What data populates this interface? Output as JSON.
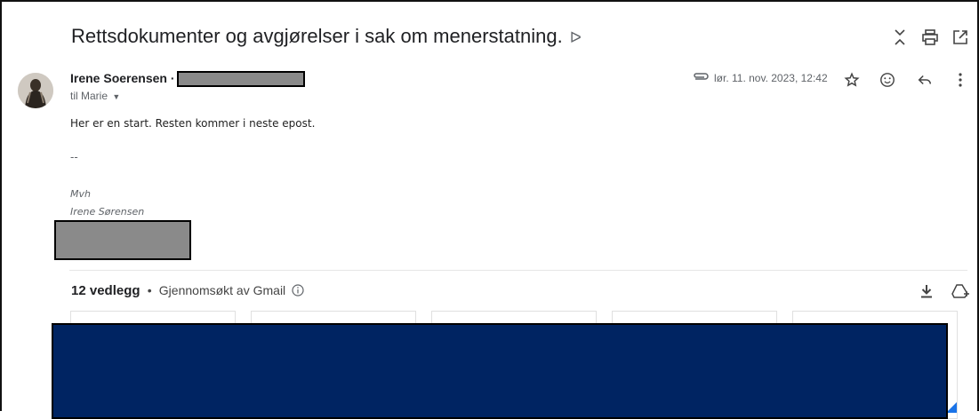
{
  "email": {
    "subject": "Rettsdokumenter og avgjørelser i sak om menerstatning.",
    "importance_marker": "ᐅ",
    "sender_name": "Irene Soerensen",
    "sender_separator": "·",
    "recipient_line": "til Marie",
    "date": "lør. 11. nov. 2023, 12:42",
    "body_line": "Her er en start. Resten kommer i neste epost.",
    "separator": "--",
    "closing": "Mvh",
    "signature_name": "Irene Sørensen"
  },
  "attachments": {
    "count_label": "12 vedlegg",
    "bullet": "•",
    "scan_label": "Gjennomsøkt av Gmail"
  },
  "icons": {
    "collapse": "collapse-all-icon",
    "print": "print-icon",
    "popout": "open-in-new-window-icon",
    "attachment": "paperclip-icon",
    "star": "star-icon",
    "emoji": "emoji-reaction-icon",
    "reply": "reply-icon",
    "more": "more-vertical-icon",
    "download": "download-all-icon",
    "drive": "add-to-drive-icon",
    "info": "info-icon"
  },
  "colors": {
    "redaction_dark": "#002462",
    "redaction_gray": "#8a8a8a",
    "text_primary": "#202124",
    "text_secondary": "#5f6368"
  }
}
